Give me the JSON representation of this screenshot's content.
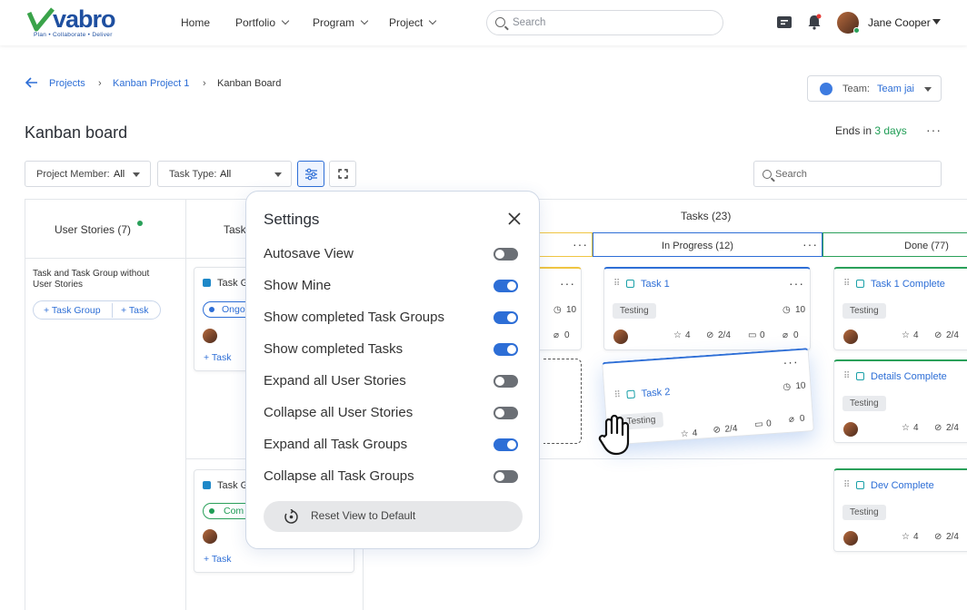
{
  "app": {
    "logo": "vabro",
    "tagline": "Plan • Collaborate • Deliver"
  },
  "nav": {
    "home": "Home",
    "portfolio": "Portfolio",
    "program": "Program",
    "project": "Project"
  },
  "search_top": {
    "placeholder": "Search"
  },
  "user": {
    "name": "Jane Cooper"
  },
  "breadcrumb": {
    "projects": "Projects",
    "project": "Kanban Project 1",
    "current": "Kanban Board"
  },
  "team": {
    "label": "Team:",
    "value": "Team jai"
  },
  "page": {
    "title": "Kanban board",
    "ends_prefix": "Ends in",
    "ends_value": "3 days"
  },
  "filters": {
    "member_label": "Project Member:",
    "member_value": "All",
    "type_label": "Task Type:",
    "type_value": "All",
    "search_placeholder": "Search"
  },
  "board": {
    "user_stories_header": "User Stories (7)",
    "task_groups_header": "Task",
    "tasks_header": "Tasks (23)",
    "in_progress": "In Progress (12)",
    "done": "Done (77)",
    "story_title": "Task and Task Group without User Stories",
    "add_task_group": "+ Task Group",
    "add_task": "+ Task"
  },
  "group_cards": [
    {
      "title": "Task G",
      "status": "Ongo",
      "add": "+ Task"
    },
    {
      "title": "Task G",
      "status": "Com",
      "add": "+ Task"
    }
  ],
  "todo_partial": {
    "hours": "10",
    "attach": "0"
  },
  "in_progress_cards": [
    {
      "title": "Task 1",
      "tag": "Testing",
      "hours": "10",
      "stars": "4",
      "checks": "2/4",
      "comments": "0",
      "attach": "0"
    }
  ],
  "dragged_card": {
    "title": "Task 2",
    "tag": "Testing",
    "hours": "10",
    "stars": "4",
    "checks": "2/4",
    "comments": "0",
    "attach": "0"
  },
  "done_cards": [
    {
      "title": "Task 1 Complete",
      "tag": "Testing",
      "stars": "4",
      "checks": "2/4"
    },
    {
      "title": "Details Complete",
      "tag": "Testing",
      "stars": "4",
      "checks": "2/4"
    },
    {
      "title": "Dev Complete",
      "tag": "Testing",
      "stars": "4",
      "checks": "2/4"
    }
  ],
  "settings": {
    "title": "Settings",
    "options": [
      {
        "label": "Autosave View",
        "on": false
      },
      {
        "label": "Show Mine",
        "on": true
      },
      {
        "label": "Show completed Task Groups",
        "on": true
      },
      {
        "label": "Show completed Tasks",
        "on": true
      },
      {
        "label": "Expand all User Stories",
        "on": false
      },
      {
        "label": "Collapse all User Stories",
        "on": false
      },
      {
        "label": "Expand all Task Groups",
        "on": true
      },
      {
        "label": "Collapse all Task Groups",
        "on": false
      }
    ],
    "reset": "Reset View to Default"
  },
  "colors": {
    "accent": "#2d6ed6",
    "success": "#1f9d55",
    "done_border": "#2aa05a",
    "todo_border": "#f0c542"
  }
}
